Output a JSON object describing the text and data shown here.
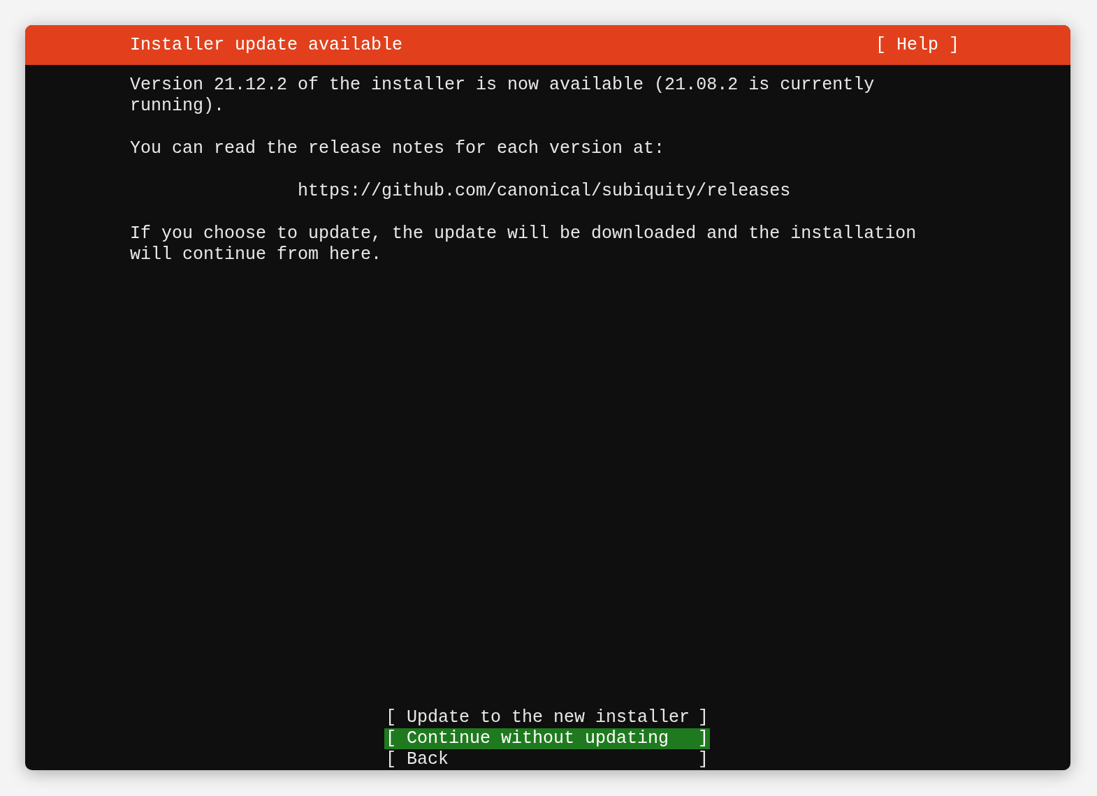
{
  "header": {
    "title": "Installer update available",
    "help": "[ Help ]"
  },
  "paragraphs": [
    {
      "kind": "text",
      "text": "Version 21.12.2 of the installer is now available (21.08.2 is currently running)."
    },
    {
      "kind": "text",
      "text": "You can read the release notes for each version at:"
    },
    {
      "kind": "link",
      "text": "https://github.com/canonical/subiquity/releases"
    },
    {
      "kind": "text",
      "text": "If you choose to update, the update will be downloaded and the installation will continue from here."
    }
  ],
  "buttons": [
    {
      "open": "[",
      "label": "Update to the new installer",
      "close": "]",
      "selected": false
    },
    {
      "open": "[",
      "label": "Continue without updating",
      "close": "]",
      "selected": true
    },
    {
      "open": "[",
      "label": "Back",
      "close": "]",
      "selected": false
    }
  ]
}
